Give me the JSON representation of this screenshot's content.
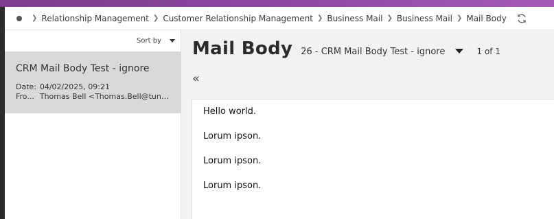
{
  "breadcrumb": {
    "items": [
      "Relationship Management",
      "Customer Relationship Management",
      "Business Mail",
      "Business Mail",
      "Mail Body"
    ]
  },
  "list": {
    "sort_label": "Sort by",
    "item": {
      "subject": "CRM Mail Body Test - ignore",
      "date_label": "Date:",
      "date_value": "04/02/2025, 09:21",
      "from_label": "Fro...",
      "from_value": "Thomas Bell <Thomas.Bell@tunsta..."
    }
  },
  "detail": {
    "title": "Mail Body",
    "record": "26 - CRM Mail Body Test - ignore",
    "count": "1 of 1",
    "collapse_glyph": "«",
    "body_lines": [
      "Hello world.",
      "Lorum ipson.",
      "Lorum ipson.",
      "Lorum ipson."
    ]
  },
  "colors": {
    "topbar": "#8e4aa1",
    "selected_item": "#d9d9d9"
  }
}
